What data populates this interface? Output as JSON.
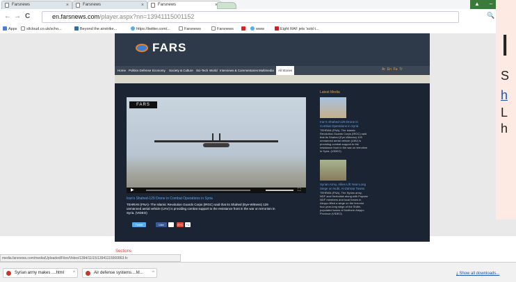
{
  "browser": {
    "tabs": [
      {
        "title": "Farsnews",
        "active": false
      },
      {
        "title": "Farsnews",
        "active": false
      },
      {
        "title": "Farsnews",
        "active": true
      }
    ],
    "url_host": "en.farsnews.com",
    "url_path": "/player.aspx?nn=13941115001152",
    "bookmarks": [
      "Apps",
      "sllcloud.co.uk/scho...",
      "Beyond the airstrike...",
      "https://twitter.com/...",
      "Farsnews",
      "Farsnews",
      "www",
      "Eight RAF jets 'sold t..."
    ],
    "status_url": "media.farsnews.com/media/Uploaded/Files/Video/1394/11/15/13941115000863.fv",
    "downloads": [
      {
        "name": "Syrian army makes ....html"
      },
      {
        "name": "Air defense systems....M..."
      }
    ],
    "show_all_downloads": "Show all downloads..."
  },
  "site": {
    "logo": "FARS",
    "menu": [
      "Home",
      "Politics Defense",
      "Economy",
      "Society & Culture",
      "Sci-Tech",
      "World",
      "Interviews & Commentaries",
      "Multimedia",
      "All Stories"
    ],
    "languages": [
      "Ar",
      "En",
      "Fa",
      "Tr"
    ],
    "video_badge": "FARS",
    "video_title": "Iran's Shahed-129 Drone in Combat Operations in Syria",
    "video_desc": "TEHRAN (FNA)- The Islamic Revolution Guards Corps (IRGC) said that its Shahed (Eye-Witness) 129 unmanned aerial vehicle (UAV) is providing combat support to the resistance front in the war on terrorism in Syria. (VIDEO)",
    "share": [
      "Tweet",
      "Like",
      "G+1",
      "+1"
    ],
    "latest_header": "Latest Media",
    "latest": [
      {
        "title": "Iran's Shahed-129 Drone in Combat Operations in Syria",
        "text": "TEHRAN (FNA)- The Islamic Revolution Guards Corps (IRGC) said that its Shahed (Eye-Witness) 129 unmanned aerial vehicle (UAV) is providing combat support to the resistance front in the war on terrorism in Syria. (VIDEO)"
      },
      {
        "title": "Syrian Army, Allies Lift Year-Long Siege on Nubl, Al-Zahraa Towns",
        "text": "TEHRAN (FNA)- The Syrian army, NDF and Hezbollah along with Popular NDF members and local forces in Aleppo lifted a siege on the terrorist four-year-long siege of the Shiite-populated towns of Northern Aleppo Province (VIDEO)"
      }
    ],
    "footer_label": "Sections"
  },
  "slide": {
    "title": "I",
    "lines": [
      "S",
      "h",
      "L",
      "h"
    ]
  },
  "colors": {
    "site_bg": "#1b2432",
    "accent_orange": "#e9a133",
    "link_blue": "#6ea3dd",
    "slide_bg": "#fdebe3"
  }
}
